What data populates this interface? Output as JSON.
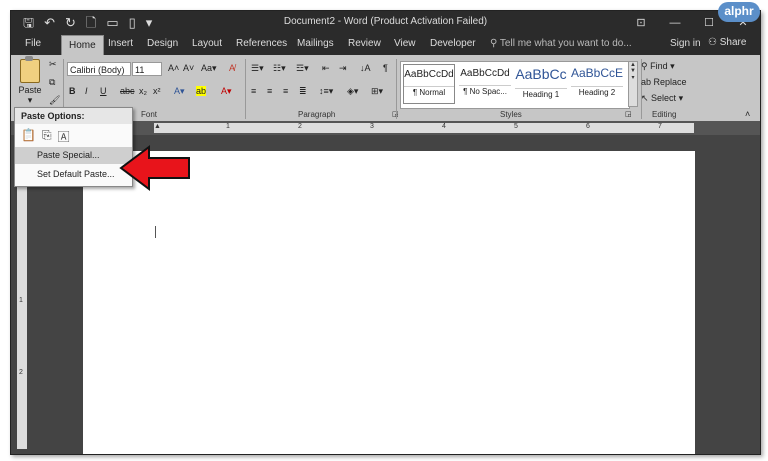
{
  "badge": {
    "logo_text": "alphr"
  },
  "window": {
    "title": "Document2 - Word (Product Activation Failed)"
  },
  "quick_access": {
    "save_icon": "save-icon",
    "undo_icon": "undo-icon",
    "redo_icon": "redo-icon"
  },
  "tabs": [
    {
      "label": "File"
    },
    {
      "label": "Home"
    },
    {
      "label": "Insert"
    },
    {
      "label": "Design"
    },
    {
      "label": "Layout"
    },
    {
      "label": "References"
    },
    {
      "label": "Mailings"
    },
    {
      "label": "Review"
    },
    {
      "label": "View"
    },
    {
      "label": "Developer"
    }
  ],
  "tellme": {
    "placeholder": "Tell me what you want to do..."
  },
  "account": {
    "signin": "Sign in",
    "share": "Share"
  },
  "clipboard": {
    "paste_label": "Paste"
  },
  "font": {
    "family": "Calibri (Body)",
    "size": "11",
    "group_label": "Font"
  },
  "paragraph": {
    "group_label": "Paragraph"
  },
  "styles": {
    "group_label": "Styles",
    "items": [
      {
        "sample": "AaBbCcDd",
        "name": "¶ Normal"
      },
      {
        "sample": "AaBbCcDd",
        "name": "¶ No Spac..."
      },
      {
        "sample": "AaBbCc",
        "name": "Heading 1"
      },
      {
        "sample": "AaBbCcE",
        "name": "Heading 2"
      }
    ]
  },
  "editing": {
    "group_label": "Editing",
    "find": "Find",
    "replace": "Replace",
    "select": "Select"
  },
  "ruler": {
    "marks": [
      "1",
      "2",
      "3",
      "4",
      "5",
      "6",
      "7"
    ],
    "vmarks": [
      "1",
      "2"
    ]
  },
  "paste_menu": {
    "header": "Paste Options:",
    "items": [
      "Paste Special...",
      "Set Default Paste..."
    ]
  },
  "colors": {
    "annotation_arrow": "#e8141b",
    "title_bar": "#2b2b2b",
    "ribbon": "#c6c6c6"
  }
}
